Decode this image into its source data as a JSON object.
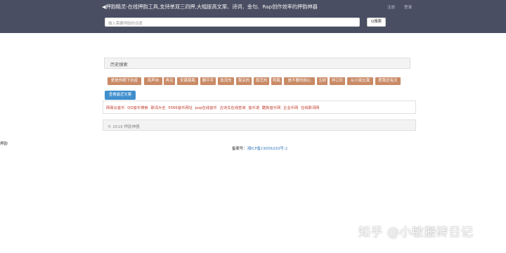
{
  "header": {
    "brand": "◀押韵精灵-在线押韵工具,支持单双三四押,大幅提高文案、诗词、金句、Rap创作效率的押韵神器",
    "links": [
      "注册",
      "登录"
    ],
    "search_placeholder": "输入需要押韵的词语",
    "search_button": "Q搜索"
  },
  "history": {
    "title": "历史搜索",
    "tags": [
      "爱是你眼下抗疫",
      "鸡声自",
      "再见",
      "安慕瓶瓶",
      "躺平手",
      "急流车",
      "我买的",
      "寂芝的",
      "阿瓶",
      "是不要的耐心",
      "玉树",
      "伴口乐",
      "从小就比我",
      "愿我还有天"
    ],
    "show_all": "查看最近文案"
  },
  "links": [
    "网易云音乐",
    "QQ音乐搜索",
    "歌词大全",
    "5566音乐网址",
    "pop在线音乐",
    "古诗文在线查询",
    "音乐道",
    "酷狗音乐网",
    "企业乐网",
    "在线歌词网"
  ],
  "footer": {
    "copyright": "© 2019 押韵神器",
    "broken_image_alt": "押韵",
    "icp_label": "备案号：",
    "icp_number": "湘ICP备19056293号-2"
  },
  "watermark": "知乎 @小敏搬砖日记",
  "colors": {
    "topbar": "#4a4e62",
    "tag": "#c98a66",
    "show_all_button": "#3f8fcd",
    "link": "#c0392b"
  }
}
